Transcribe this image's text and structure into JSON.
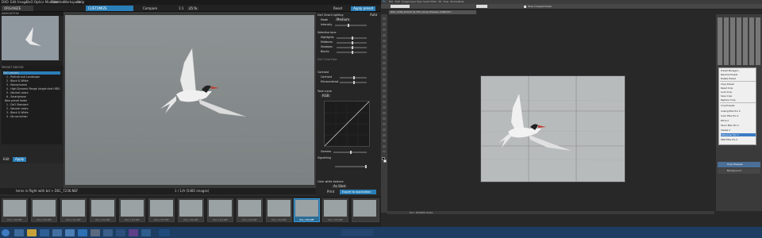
{
  "dxo": {
    "menu": [
      "DXO",
      "Edit",
      "Image",
      "DxO Optics Modules",
      "Palettes",
      "Workspace",
      "Help"
    ],
    "tab_organize": "ORGANIZE",
    "tab_customize": "CUSTOMIZE",
    "compare": "Compare",
    "zoom": "1:1",
    "zoom_pct": "25 %",
    "reset": "Reset",
    "apply_preset": "Apply preset",
    "navigation": "NAVIGATION",
    "preset_editor": "PRESET EDITOR",
    "presets": [
      "DxO presets",
      "1 - Portrait and Landscape",
      "2 - Black & White",
      "3 - Monochrome",
      "4 - High Dynamic Range (single shot HDR)",
      "5 - Neutral colors",
      "6 - Smartphone",
      "New preset folder",
      "1 - DxO Standard",
      "2 - Neutral colors",
      "3 - Black & White",
      "4 - No correction"
    ],
    "edit_btn": "Edit",
    "apply_btn": "Apply",
    "rp": {
      "smart_lighting": "DxO Smart Lighting",
      "mode": "Mode",
      "mode_val": "Medium",
      "intensity": "Intensity",
      "selective_tone": "Selective tone",
      "highlights": "Highlights",
      "midtones": "Midtones",
      "shadows": "Shadows",
      "blacks": "Blacks",
      "clearview": "DxO ClearView",
      "contrast_sec": "Contrast",
      "contrast": "Contrast",
      "microcontrast": "Microcontrast",
      "tone_curve": "Tone curve",
      "rgb": "RGB",
      "gamma": "Gamma",
      "vignetting": "Vignetting",
      "wb": "Color white balance",
      "wb_setting": "As Shot",
      "print": "Print",
      "export": "Export to application",
      "auto": "Auto"
    },
    "filmstrip_path": "terns in flight with bd > DSC_7236.NEF",
    "image_count": "1 / 1/A (5485 images)",
    "films": [
      "DSC_7128.NEF",
      "DSC_7130.NEF",
      "DSC_7131.NEF",
      "DSC_7133.NEF",
      "DSC_7135.NEF",
      "DSC_7137.NEF",
      "DSC_7139.NEF",
      "DSC_7141.NEF",
      "DSC_7143.NEF",
      "DSC_7144.NEF",
      "DSC_7236.NEF",
      "DSC_7149.NEF"
    ]
  },
  "ps": {
    "menu": [
      "Ps",
      "File",
      "Edit",
      "Image",
      "Layer",
      "Type",
      "Select",
      "Filter",
      "3D",
      "View",
      "Window",
      "Help"
    ],
    "doctab": "DSC_7236_DxO.tif @ 25% (Crop Preview, RGB/16*)",
    "hide_crop": "Hide Cropped Pixels",
    "zoom_status": "Doc: 98.9M/0 bytes",
    "menu_items": [
      "Preset Manager...",
      "Rename Preset",
      "Delete Preset",
      "Copy Preset",
      "Reset Crop",
      "Load Crop",
      "Save Crop",
      "Replace Crop",
      "Crop Presets",
      "Analog Efex Pro 2",
      "Color Efex Pro 4",
      "Dfine 2",
      "Silver Efex Pro 2",
      "Viveza 2",
      "Sharpener Pro 3",
      "HDR Efex Pro 2"
    ],
    "layers": [
      "Crop Preview",
      "Background"
    ]
  },
  "colors": {
    "dxo_accent": "#2a7fb8",
    "taskbar": "#1d3d63"
  }
}
